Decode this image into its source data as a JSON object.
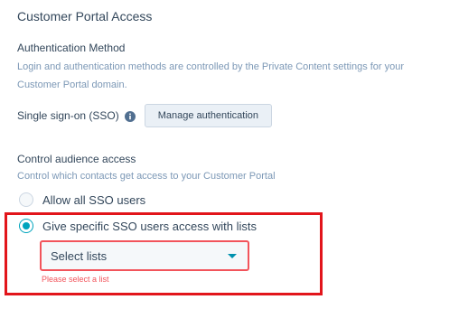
{
  "section": {
    "title": "Customer Portal Access"
  },
  "authentication": {
    "heading": "Authentication Method",
    "help": "Login and authentication methods are controlled by the Private Content settings for your Customer Portal domain.",
    "sso_label": "Single sign-on (SSO)",
    "info_icon": "info-icon",
    "manage_button": "Manage authentication"
  },
  "audience": {
    "heading": "Control audience access",
    "help": "Control which contacts get access to your Customer Portal",
    "options": [
      {
        "label": "Allow all SSO users",
        "selected": false
      },
      {
        "label": "Give specific SSO users access with lists",
        "selected": true
      }
    ],
    "select": {
      "value": "Select lists",
      "caret_icon": "caret-down-icon"
    },
    "error": "Please select a list"
  },
  "colors": {
    "accent": "#00a4bd",
    "error": "#f2545b",
    "highlight": "#e2151b",
    "text": "#33475b",
    "muted": "#7c98b6"
  }
}
